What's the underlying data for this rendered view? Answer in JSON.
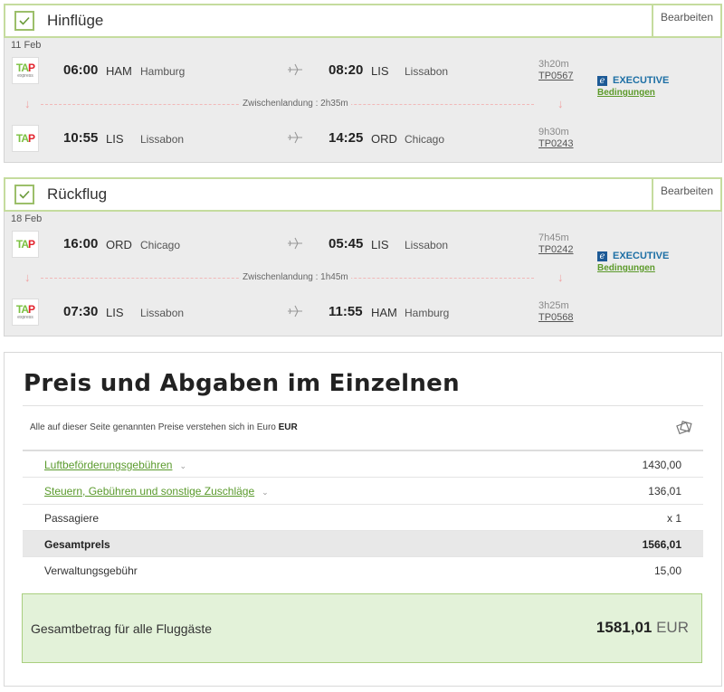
{
  "outbound": {
    "title": "Hinflüge",
    "edit_label": "Bearbeiten",
    "date": "11 Feb",
    "segments": [
      {
        "logo": "tap-express",
        "dep_time": "06:00",
        "dep_code": "HAM",
        "dep_city": "Hamburg",
        "arr_time": "08:20",
        "arr_code": "LIS",
        "arr_city": "Lissabon",
        "duration": "3h20m",
        "flight": "TP0567"
      },
      {
        "logo": "tap",
        "dep_time": "10:55",
        "dep_code": "LIS",
        "dep_city": "Lissabon",
        "arr_time": "14:25",
        "arr_code": "ORD",
        "arr_city": "Chicago",
        "duration": "9h30m",
        "flight": "TP0243"
      }
    ],
    "layover": "Zwischenlandung : 2h35m",
    "cabin": "EXECUTIVE",
    "conditions": "Bedingungen"
  },
  "inbound": {
    "title": "Rückflug",
    "edit_label": "Bearbeiten",
    "date": "18 Feb",
    "segments": [
      {
        "logo": "tap",
        "dep_time": "16:00",
        "dep_code": "ORD",
        "dep_city": "Chicago",
        "arr_time": "05:45",
        "arr_code": "LIS",
        "arr_city": "Lissabon",
        "duration": "7h45m",
        "flight": "TP0242"
      },
      {
        "logo": "tap-express",
        "dep_time": "07:30",
        "dep_code": "LIS",
        "dep_city": "Lissabon",
        "arr_time": "11:55",
        "arr_code": "HAM",
        "arr_city": "Hamburg",
        "duration": "3h25m",
        "flight": "TP0568"
      }
    ],
    "layover": "Zwischenlandung : 1h45m",
    "cabin": "EXECUTIVE",
    "conditions": "Bedingungen"
  },
  "logo_text": {
    "t": "T",
    "a": "A",
    "p": "P",
    "express": "express"
  },
  "price": {
    "title": "Preis und Abgaben im Einzelnen",
    "note_prefix": "Alle auf dieser Seite genannten Preise verstehen sich in Euro",
    "note_currency": "EUR",
    "rows": [
      {
        "label": "Luftbeförderungsgebühren",
        "value": "1430,00"
      },
      {
        "label": "Steuern, Gebühren und sonstige Zuschläge",
        "value": "136,01"
      },
      {
        "label": "Passagiere",
        "value": "x 1"
      },
      {
        "label": "Gesamtprels",
        "value": "1566,01"
      },
      {
        "label": "Verwaltungsgebühr",
        "value": "15,00"
      }
    ],
    "grand_label": "Gesamtbetrag für alle Fluggäste",
    "grand_value": "1581,01",
    "grand_currency": "EUR"
  },
  "icons": {
    "chevron": "⌄",
    "arrow_down": "↓",
    "e": "e"
  }
}
